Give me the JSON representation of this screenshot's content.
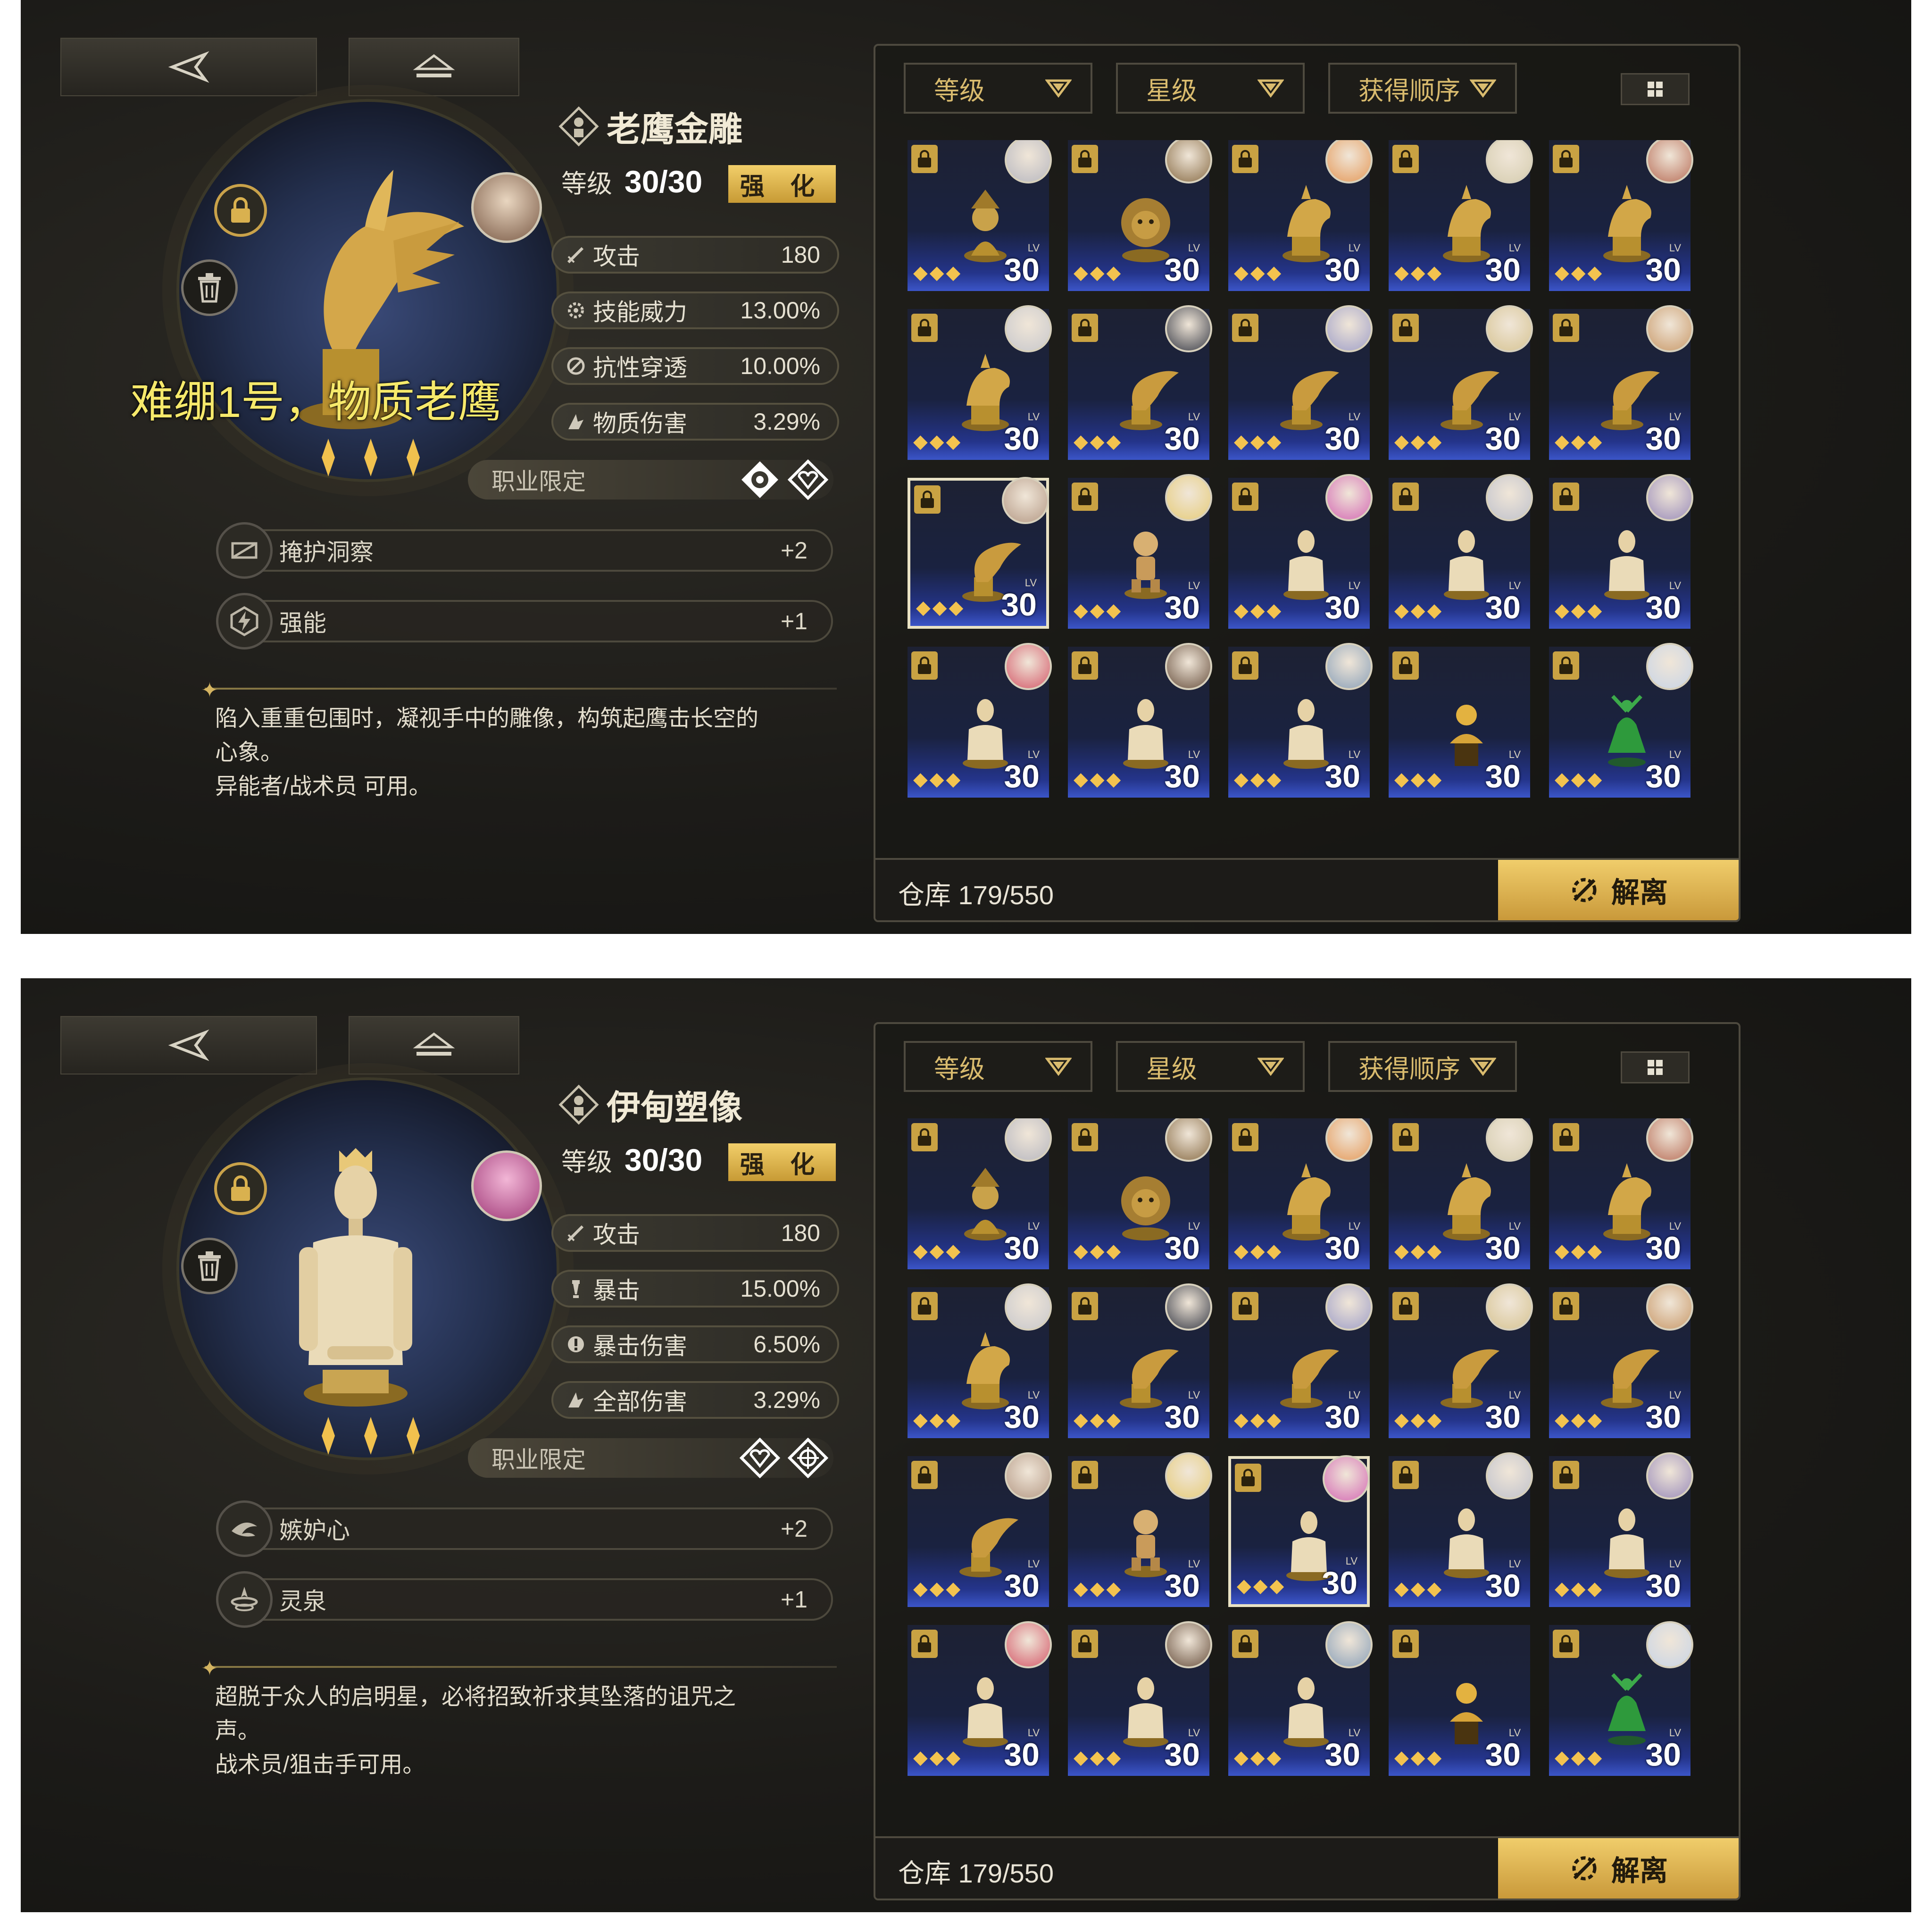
{
  "panels": [
    {
      "title": "老鹰金雕",
      "level_label": "等级",
      "level_value": "30/30",
      "enhance_label": "强 化",
      "overlay_note": "难绷1号，物质老鹰",
      "stats": [
        {
          "icon": "sword-icon",
          "label": "攻击",
          "value": "180"
        },
        {
          "icon": "gear-icon",
          "label": "技能威力",
          "value": "13.00%"
        },
        {
          "icon": "shield-pierce-icon",
          "label": "抗性穿透",
          "value": "10.00%"
        },
        {
          "icon": "matter-damage-icon",
          "label": "物质伤害",
          "value": "3.29%"
        }
      ],
      "job_limit_label": "职业限定",
      "job_icons": [
        "esper-class-icon",
        "tactician-class-icon"
      ],
      "skills": [
        {
          "icon": "cover-insight-icon",
          "label": "掩护洞察",
          "value": "+2"
        },
        {
          "icon": "empower-icon",
          "label": "强能",
          "value": "+1"
        }
      ],
      "description": "陷入重重包围时，凝视手中的雕像，构筑起鹰击长空的\n心象。\n异能者/战术员 可用。",
      "filters": {
        "f1": "等级",
        "f2": "星级",
        "f3": "获得顺序"
      },
      "storage": "仓库 179/550",
      "dissolve": "解离",
      "selected_index": 10
    },
    {
      "title": "伊甸塑像",
      "level_label": "等级",
      "level_value": "30/30",
      "enhance_label": "强 化",
      "overlay_note": "",
      "stats": [
        {
          "icon": "sword-icon",
          "label": "攻击",
          "value": "180"
        },
        {
          "icon": "crit-icon",
          "label": "暴击",
          "value": "15.00%"
        },
        {
          "icon": "crit-damage-icon",
          "label": "暴击伤害",
          "value": "6.50%"
        },
        {
          "icon": "all-damage-icon",
          "label": "全部伤害",
          "value": "3.29%"
        }
      ],
      "job_limit_label": "职业限定",
      "job_icons": [
        "tactician-class-icon",
        "sniper-class-icon"
      ],
      "skills": [
        {
          "icon": "jealousy-icon",
          "label": "嫉妒心",
          "value": "+2"
        },
        {
          "icon": "spirit-spring-icon",
          "label": "灵泉",
          "value": "+1"
        }
      ],
      "description": "超脱于众人的启明星，必将招致祈求其坠落的诅咒之\n声。\n战术员/狙击手可用。",
      "filters": {
        "f1": "等级",
        "f2": "星级",
        "f3": "获得顺序"
      },
      "storage": "仓库 179/550",
      "dissolve": "解离",
      "selected_index": 12
    }
  ],
  "item_level": "30",
  "item_lv_tag": "LV",
  "items": [
    {
      "kind": "bust",
      "avatar_color": "#b8b8c0"
    },
    {
      "kind": "lion",
      "avatar_color": "#8a6e48"
    },
    {
      "kind": "wolf",
      "avatar_color": "#e59a5a"
    },
    {
      "kind": "wolf",
      "avatar_color": "#d6cdb0"
    },
    {
      "kind": "wolf",
      "avatar_color": "#b9705a"
    },
    {
      "kind": "wolf",
      "avatar_color": "#c8c8cc"
    },
    {
      "kind": "eagle",
      "avatar_color": "#3a3d48"
    },
    {
      "kind": "eagle",
      "avatar_color": "#a0a0c8"
    },
    {
      "kind": "eagle",
      "avatar_color": "#d7c493"
    },
    {
      "kind": "eagle",
      "avatar_color": "#c99a6a"
    },
    {
      "kind": "eagle",
      "avatar_color": "#b59a86"
    },
    {
      "kind": "puppet",
      "avatar_color": "#e6cc7a"
    },
    {
      "kind": "mannequin",
      "avatar_color": "#d46ab4"
    },
    {
      "kind": "mannequin",
      "avatar_color": "#c0c2cc"
    },
    {
      "kind": "mannequin",
      "avatar_color": "#9a8cba"
    },
    {
      "kind": "mannequin",
      "avatar_color": "#d45a6a"
    },
    {
      "kind": "mannequin",
      "avatar_color": "#6a5240"
    },
    {
      "kind": "mannequin",
      "avatar_color": "#8aa0b8"
    },
    {
      "kind": "golden-bust",
      "avatar_color": ""
    },
    {
      "kind": "green-dancer",
      "avatar_color": "#c8d4e6"
    },
    {
      "kind": "partial",
      "avatar_color": ""
    },
    {
      "kind": "partial",
      "avatar_color": "#b8b4aa"
    },
    {
      "kind": "partial",
      "avatar_color": "#c2a888"
    },
    {
      "kind": "partial",
      "avatar_color": ""
    },
    {
      "kind": "partial",
      "avatar_color": ""
    }
  ],
  "colors": {
    "gold": "#d4b15c",
    "rarity_blue": "#3b55c8",
    "overlay_yellow": "#f6e96b"
  }
}
